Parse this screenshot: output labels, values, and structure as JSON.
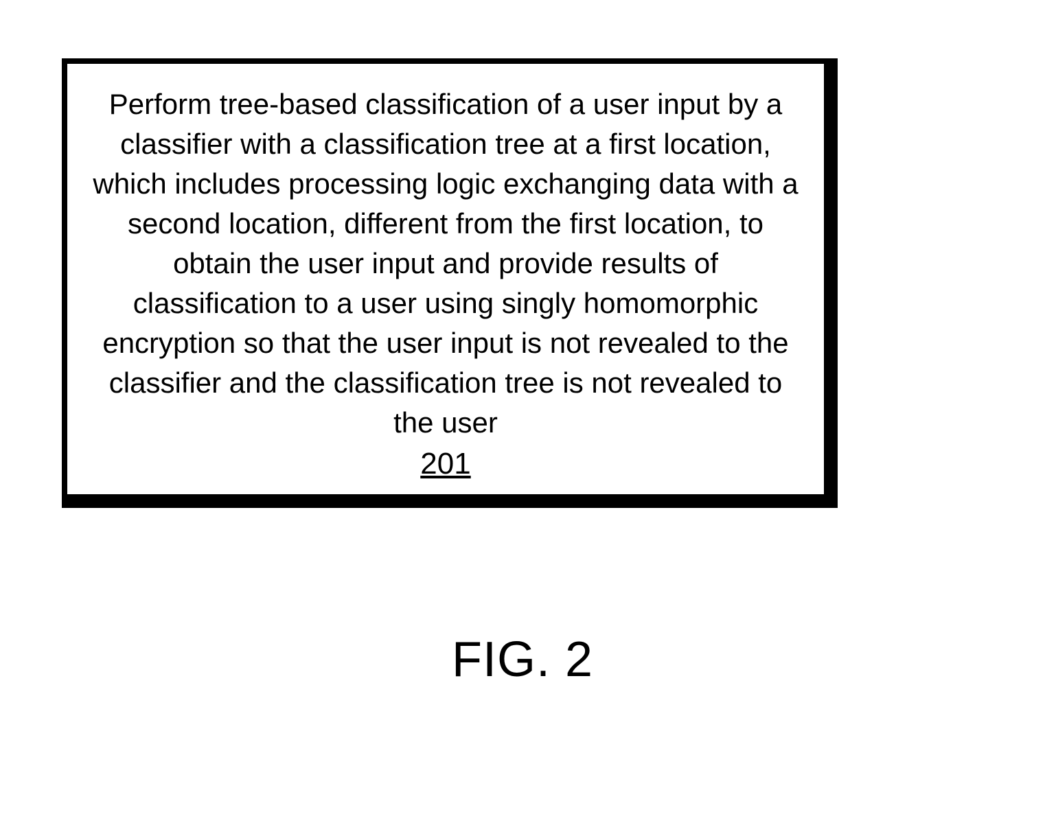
{
  "figure": {
    "label": "FIG. 2"
  },
  "step": {
    "text": "Perform tree-based classification of a user input by a classifier with a classification tree at a first location, which includes processing logic exchanging data with a second location, different from the first location, to obtain the user input and provide results of classification to a user using singly homomorphic encryption so that the user input is not revealed to the classifier and the classification tree is not revealed to the user",
    "ref": "201"
  }
}
